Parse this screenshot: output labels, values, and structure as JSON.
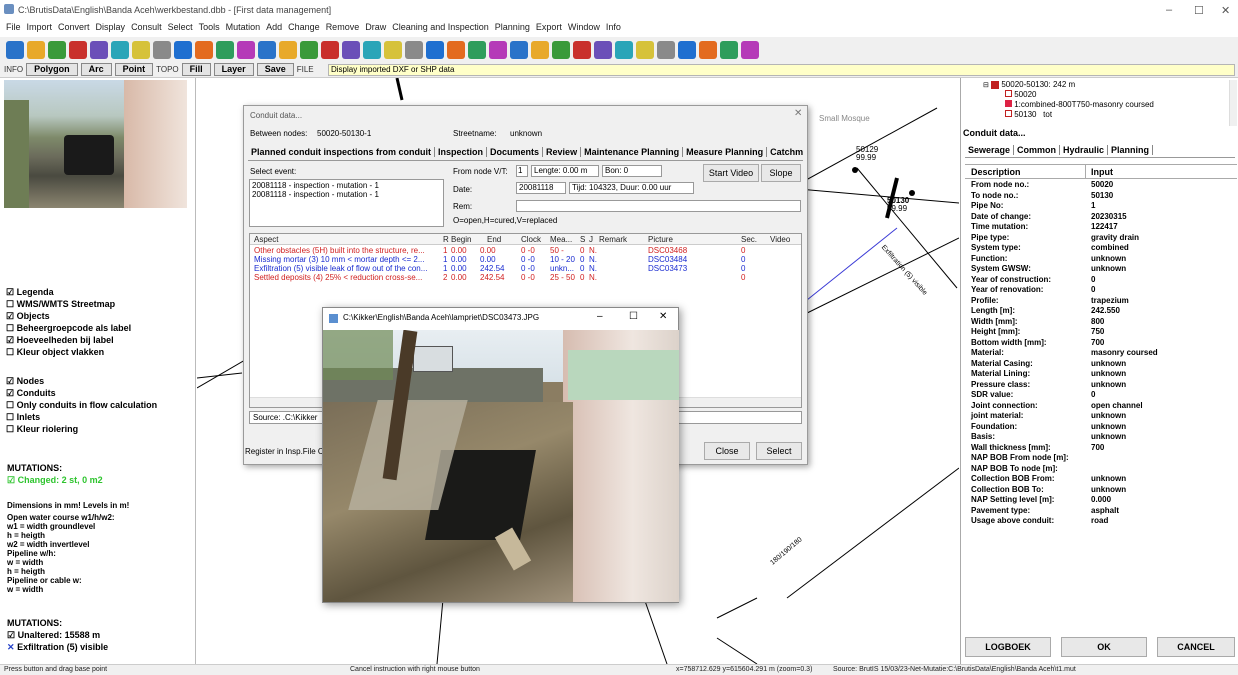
{
  "window": {
    "title": "C:\\BrutisData\\English\\Banda Aceh\\werkbestand.dbb - [First data management]",
    "min": "–",
    "max": "☐",
    "close": "✕"
  },
  "menu": [
    "File",
    "Import",
    "Convert",
    "Display",
    "Consult",
    "Select",
    "Tools",
    "Mutation",
    "Add",
    "Change",
    "Remove",
    "Draw",
    "Cleaning and Inspection",
    "Planning",
    "Export",
    "Window",
    "Info"
  ],
  "toolbar_colors": [
    "#2a73c9",
    "#e8a92a",
    "#3a9a3a",
    "#c9302c",
    "#6b4fb8",
    "#2aa5b8",
    "#d6c23a",
    "#8a8a8a",
    "#1f6fd0",
    "#e36b1f",
    "#2e9d5c",
    "#b53ab8"
  ],
  "modebar": {
    "info": "INFO",
    "polygon": "Polygon",
    "arc": "Arc",
    "point": "Point",
    "topo": "TOPO",
    "fill": "Fill",
    "layer": "Layer",
    "save": "Save",
    "file": "FILE",
    "hint": "Display imported DXF or SHP data"
  },
  "left": {
    "checks": [
      {
        "label": "Legenda",
        "checked": true
      },
      {
        "label": "WMS/WMTS Streetmap",
        "checked": false
      },
      {
        "label": "Objects",
        "checked": true
      },
      {
        "label": "Beheergroepcode als label",
        "checked": false
      },
      {
        "label": "Hoeveelheden bij label",
        "checked": true
      },
      {
        "label": "Kleur object vlakken",
        "checked": false
      }
    ],
    "checks2": [
      {
        "label": "Nodes",
        "checked": true
      },
      {
        "label": "Conduits",
        "checked": true
      },
      {
        "label": "Only conduits in flow calculation",
        "checked": false
      },
      {
        "label": "Inlets",
        "checked": false
      },
      {
        "label": "Kleur riolering",
        "checked": false
      }
    ],
    "mutations_title": "MUTATIONS:",
    "changed": "Changed: 2 st, 0 m2",
    "legend_lines": [
      "Dimensions in mm! Levels in m!",
      "Open water course w1/h/w2:",
      "w1 = width groundlevel",
      "h = heigth",
      "w2 = width invertlevel",
      "Pipeline w/h:",
      "w = width",
      "h = heigth",
      "Pipeline or cable w:",
      "w = width"
    ],
    "mutations2_title": "MUTATIONS:",
    "unaltered": "Unaltered: 15588 m",
    "exfil": "Exfiltration (5) visible"
  },
  "map": {
    "labels": [
      "50129",
      "99.99",
      "Small Mosque",
      "50130",
      "99.99",
      "Exfiltration (5) visible",
      "180/190/180"
    ]
  },
  "conduit_dialog": {
    "title": "Conduit data...",
    "between_label": "Between nodes:",
    "between_value": "50020-50130-1",
    "street_label": "Streetname:",
    "street_value": "unknown",
    "tabs": [
      "Planned conduit inspections from conduit",
      "Inspection",
      "Documents",
      "Review",
      "Maintenance Planning",
      "Measure Planning",
      "Catchm"
    ],
    "select_event": "Select event:",
    "events": [
      "20081118 - inspection - mutation  - 1",
      "20081118 - inspection - mutation  - 1"
    ],
    "from_node": "From node V/T:",
    "from_val": "1",
    "length": "Lengte: 0.00 m",
    "bon": "Bon: 0",
    "date_label": "Date:",
    "date_val": "20081118",
    "time_val": "Tijd: 104323, Duur: 0.00 uur",
    "rem_label": "Rem:",
    "legend": "O=open,H=cured,V=replaced",
    "start_video": "Start Video",
    "slope": "Slope",
    "columns": [
      "Aspect",
      "R",
      "Begin",
      "End",
      "Clock",
      "Mea...",
      "S",
      "J",
      "Remark",
      "Picture",
      "Sec.",
      "Video"
    ],
    "rows": [
      {
        "aspect": "Other obstacles (5H) built into the structure, re...",
        "r": "1",
        "begin": "0.00",
        "end": "0.00",
        "clock": "0 -0",
        "mea": "50 -",
        "s": "0",
        "j": "N.",
        "pic": "DSC03468",
        "sec": "0",
        "color": "#d02020"
      },
      {
        "aspect": "Missing mortar (3) 10 mm < mortar depth <= 2...",
        "r": "1",
        "begin": "0.00",
        "end": "0.00",
        "clock": "0 -0",
        "mea": "10 - 20",
        "s": "0",
        "j": "N.",
        "pic": "DSC03484",
        "sec": "0",
        "color": "#1a2bd0"
      },
      {
        "aspect": "Exfiltration (5) visible leak of flow out of the con...",
        "r": "1",
        "begin": "0.00",
        "end": "242.54",
        "clock": "0 -0",
        "mea": "unkn...",
        "s": "0",
        "j": "N.",
        "pic": "DSC03473",
        "sec": "0",
        "color": "#1a2bd0"
      },
      {
        "aspect": "Settled deposits (4) 25% <  reduction cross-se...",
        "r": "2",
        "begin": "0.00",
        "end": "242.54",
        "clock": "0 -0",
        "mea": "25 - 50",
        "s": "0",
        "j": "N.",
        "pic": "",
        "sec": "0",
        "color": "#d02020"
      }
    ],
    "source": "Source: .C:\\Kikker",
    "register": "Register in Insp.File C",
    "close": "Close",
    "select": "Select"
  },
  "photo": {
    "title": "C:\\Kikker\\English\\Banda Aceh\\lampriet\\DSC03473.JPG"
  },
  "right": {
    "tree": [
      "50020-50130: 242 m",
      "50020",
      "1:combined-800T750-masonry coursed",
      "50130",
      "tot"
    ],
    "title": "Conduit data...",
    "tabs": [
      "Sewerage",
      "Common",
      "Hydraulic",
      "Planning"
    ],
    "col_desc": "Description",
    "col_input": "Input",
    "props": [
      [
        "From node no.:",
        "50020"
      ],
      [
        "To node no.:",
        "50130"
      ],
      [
        "Pipe No:",
        "1"
      ],
      [
        "Date of change:",
        "20230315"
      ],
      [
        "Time mutation:",
        "122417"
      ],
      [
        "Pipe type:",
        "gravity drain"
      ],
      [
        "System type:",
        "combined"
      ],
      [
        "Function:",
        "unknown"
      ],
      [
        "System GWSW:",
        "unknown"
      ],
      [
        "Year of construction:",
        "0"
      ],
      [
        "Year of renovation:",
        "0"
      ],
      [
        "Profile:",
        "trapezium"
      ],
      [
        "Length [m]:",
        "242.550"
      ],
      [
        "Width [mm]:",
        "800"
      ],
      [
        "Height [mm]:",
        "750"
      ],
      [
        "Bottom width [mm]:",
        "700"
      ],
      [
        "Material:",
        "masonry coursed"
      ],
      [
        "Material Casing:",
        "unknown"
      ],
      [
        "Material Lining:",
        "unknown"
      ],
      [
        "Pressure class:",
        "unknown"
      ],
      [
        "SDR value:",
        "0"
      ],
      [
        "Joint connection:",
        "open channel"
      ],
      [
        "joint material:",
        "unknown"
      ],
      [
        "Foundation:",
        "unknown"
      ],
      [
        "Basis:",
        "unknown"
      ],
      [
        "Wall thickness [mm]:",
        "700"
      ],
      [
        "NAP BOB From node [m]:",
        ""
      ],
      [
        "NAP BOB To node [m]:",
        ""
      ],
      [
        "Collection BOB From:",
        "unknown"
      ],
      [
        "Collection BOB To:",
        "unknown"
      ],
      [
        "NAP Setting level [m]:",
        "0.000"
      ],
      [
        "Pavement type:",
        "asphalt"
      ],
      [
        "Usage above conduit:",
        "road"
      ]
    ],
    "logboek": "LOGBOEK",
    "ok": "OK",
    "cancel": "CANCEL"
  },
  "status": {
    "left": "Press button and drag base point",
    "mid": "Cancel instruction with right mouse button",
    "coords": "x=758712.629 y=615604.291 m (zoom=0.3)",
    "source": "Source: BrutIS 15/03/23-Net-Mutatie:C:\\BrutisData\\English\\Banda Aceh\\t1.mut"
  }
}
